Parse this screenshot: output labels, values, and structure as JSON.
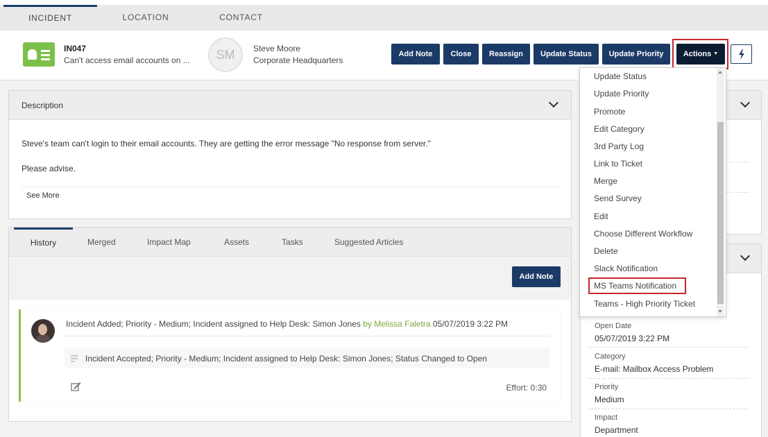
{
  "top_tabs": [
    {
      "label": "INCIDENT"
    },
    {
      "label": "LOCATION"
    },
    {
      "label": "CONTACT"
    }
  ],
  "incident": {
    "id": "IN047",
    "summary": "Can't access email accounts on ..."
  },
  "contact": {
    "initials": "SM",
    "name": "Steve Moore",
    "location": "Corporate Headquarters"
  },
  "toolbar": {
    "add_note": "Add Note",
    "close": "Close",
    "reassign": "Reassign",
    "update_status": "Update Status",
    "update_priority": "Update Priority",
    "actions": "Actions"
  },
  "description": {
    "title": "Description",
    "line1": "Steve's team can't login to their email accounts. They are getting the error message \"No response from server.\"",
    "line2": "Please advise.",
    "see_more": "See More"
  },
  "history": {
    "tabs": [
      {
        "label": "History"
      },
      {
        "label": "Merged"
      },
      {
        "label": "Impact Map"
      },
      {
        "label": "Assets"
      },
      {
        "label": "Tasks"
      },
      {
        "label": "Suggested Articles"
      }
    ],
    "add_note": "Add Note",
    "entry": {
      "text": "Incident Added; Priority - Medium; Incident assigned to Help Desk: Simon Jones",
      "by": "by Melissa Faletra",
      "timestamp": "05/07/2019 3:22 PM",
      "sub_text": "Incident Accepted; Priority - Medium; Incident assigned to Help Desk: Simon Jones; Status Changed to Open",
      "effort": "Effort: 0:30"
    }
  },
  "details": {
    "open_date_label": "Open Date",
    "open_date": "05/07/2019 3:22 PM",
    "category_label": "Category",
    "category": "E-mail: Mailbox Access Problem",
    "priority_label": "Priority",
    "priority": "Medium",
    "impact_label": "Impact",
    "impact": "Department"
  },
  "actions_menu": {
    "items": [
      {
        "label": "Update Status"
      },
      {
        "label": "Update Priority"
      },
      {
        "label": "Promote"
      },
      {
        "label": "Edit Category"
      },
      {
        "label": "3rd Party Log"
      },
      {
        "label": "Link to Ticket"
      },
      {
        "label": "Merge"
      },
      {
        "label": "Send Survey"
      },
      {
        "label": "Edit"
      },
      {
        "label": "Choose Different Workflow"
      },
      {
        "label": "Delete"
      },
      {
        "label": "Slack Notification"
      },
      {
        "label": "MS Teams Notification"
      },
      {
        "label": "Teams - High Priority Ticket"
      }
    ]
  },
  "colors": {
    "primary": "#1b3a66",
    "actions_button": "#0c1c33",
    "highlight": "#c8262e",
    "incident_icon": "#7cc04b",
    "history_accent": "#8bc34a",
    "by_user": "#7aa83f"
  }
}
